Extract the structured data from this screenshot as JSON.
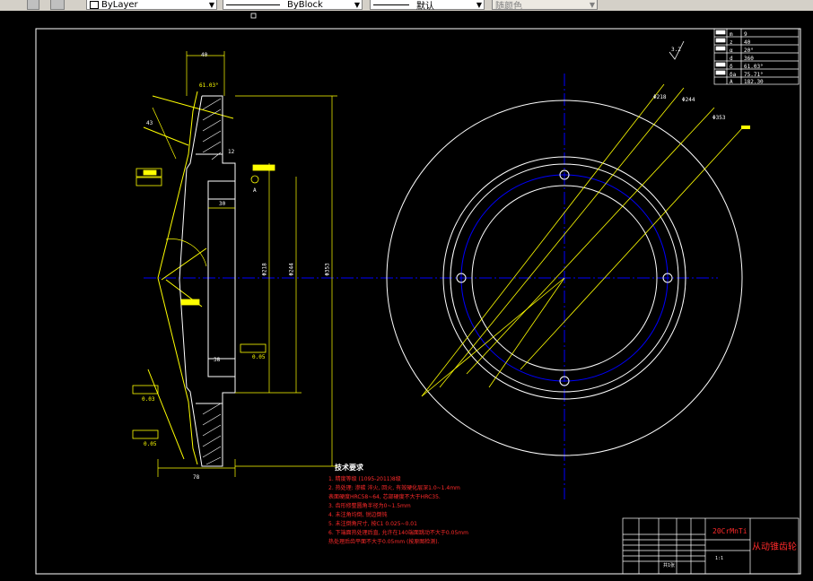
{
  "toolbar": {
    "layer_combo": "ByLayer",
    "linetype_combo": "ByBlock",
    "lineweight_combo": "默认",
    "color_combo": "随颜色"
  },
  "dimensions": {
    "d40": "40",
    "angle1": "61.03°",
    "d43": "43",
    "d12": "12",
    "d30": "30",
    "d218": "Φ218",
    "d244": "Φ244",
    "d353": "Φ353",
    "d78": "78",
    "d38": "38",
    "roughness": "3.2",
    "datum": "A",
    "tol1": "0.05",
    "tol2": "0.03",
    "tol3": "0.05"
  },
  "circle_labels": {
    "c218": "Φ218",
    "c244": "Φ244",
    "c353": "Φ353"
  },
  "parameter_table": {
    "rows": [
      {
        "sym": "m",
        "val": "9"
      },
      {
        "sym": "z",
        "val": "40"
      },
      {
        "sym": "α",
        "val": "20°"
      },
      {
        "sym": "d",
        "val": "360"
      },
      {
        "sym": "δ",
        "val": "61.03°"
      },
      {
        "sym": "δa",
        "val": "75.71°"
      },
      {
        "sym": "A",
        "val": "182.30"
      }
    ]
  },
  "requirements": {
    "title": "技术要求",
    "items": [
      "1. 精度等级 (1095-2011)8级",
      "2. 热处理: 渗碳 淬火, 回火, 有效硬化层深1.0~1.4mm",
      "   表面硬度HRC58~64, 芯部硬度不大于HRC35.",
      "3. 齿形修整圆角半径为0~1.5mm",
      "4. 未注角均倒, 锐边倒钝",
      "5. 未注倒角尺寸, 按C1 0.025~0.01",
      "6. 下端面热处理后直, 允许在140端面跳动不大于0.05mm",
      "   热处理后齿平面不大于0.05mm (按原图检测)."
    ]
  },
  "title_block": {
    "material": "20CrMnTi",
    "part_name": "从动锥齿轮",
    "scale": "1:1",
    "sheet": "共1张"
  }
}
